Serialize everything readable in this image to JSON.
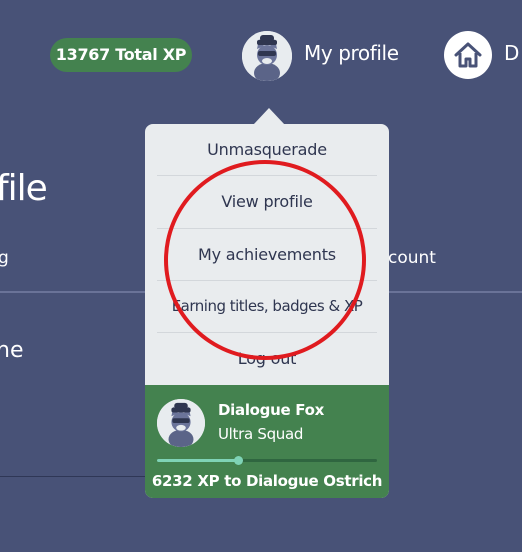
{
  "header": {
    "xp_badge": "13767 Total XP",
    "profile_label": "My profile",
    "home_label_partial": "D"
  },
  "background": {
    "heading_partial": "file",
    "tab_left_partial": "g",
    "tab_right_partial": "count",
    "subheading_partial": "ne"
  },
  "menu": {
    "items": [
      {
        "label": "Unmasquerade"
      },
      {
        "label": "View profile"
      },
      {
        "label": "My achievements"
      },
      {
        "label": "Earning titles, badges & XP"
      },
      {
        "label": "Log out"
      }
    ],
    "footer": {
      "name": "Dialogue Fox",
      "squad": "Ultra Squad",
      "progress": 0.37,
      "xp_to_next": "6232 XP to Dialogue Ostrich"
    }
  },
  "colors": {
    "page_background": "#485277",
    "accent_green": "#44824f",
    "progress_teal": "#7fd3b6",
    "highlight_red": "#e01b1f"
  },
  "icons": [
    "avatar-cat-icon",
    "home-icon"
  ]
}
